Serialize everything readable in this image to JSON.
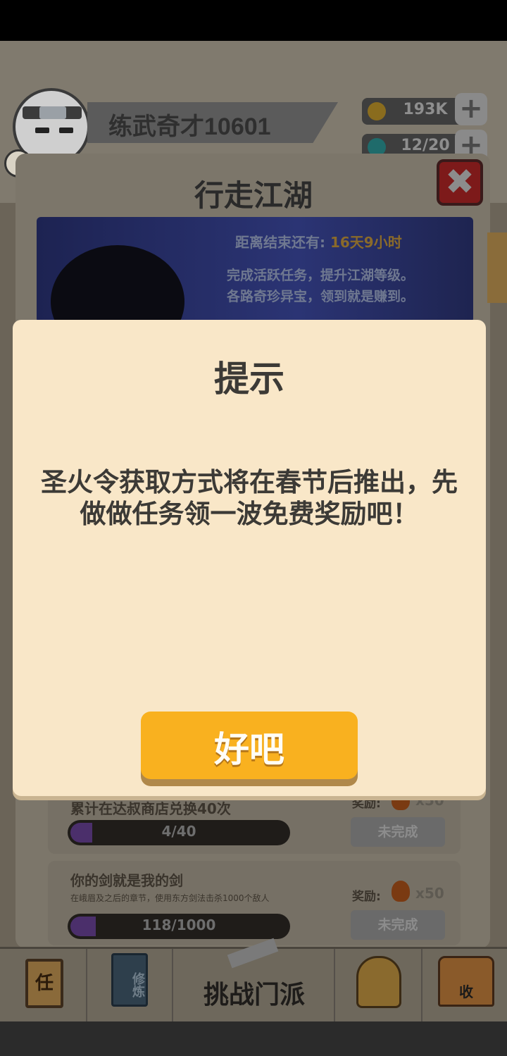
{
  "header": {
    "player_name": "练武奇才10601",
    "coins": "193K",
    "energy": "12/20",
    "coin_icon": "coin-icon",
    "gem_icon": "gem-icon"
  },
  "event_panel": {
    "title": "行走江湖",
    "countdown_label": "距离结束还有:",
    "countdown_value": "16天9小时",
    "desc_line1": "完成活跃任务，提升江湖等级。",
    "desc_line2": "各路奇珍异宝，领到就是赚到。"
  },
  "tasks": [
    {
      "title": "累计在达叔商店兑换40次",
      "progress_text": "4/40",
      "progress_fraction": 0.1,
      "reward_label": "奖励:",
      "reward_count": "x50",
      "status": "未完成"
    },
    {
      "title": "你的剑就是我的剑",
      "subtitle": "在峨眉及之后的章节，使用东方剑法击杀1000个敌人",
      "progress_text": "118/1000",
      "progress_fraction": 0.118,
      "reward_label": "奖励:",
      "reward_count": "x50",
      "status": "未完成"
    }
  ],
  "bottom_nav": {
    "task_icon_char": "任",
    "cultivate_icon_chars": "修炼",
    "challenge_label": "挑战门派",
    "collect_icon_char": "收"
  },
  "dialog": {
    "title": "提示",
    "message": "圣火令获取方式将在春节后推出，先做做任务领一波免费奖励吧！",
    "ok_label": "好吧"
  },
  "colors": {
    "dialog_bg": "#f9e7c8",
    "ok_button": "#f9b11f",
    "progress_fill": "#4b2f6b"
  }
}
